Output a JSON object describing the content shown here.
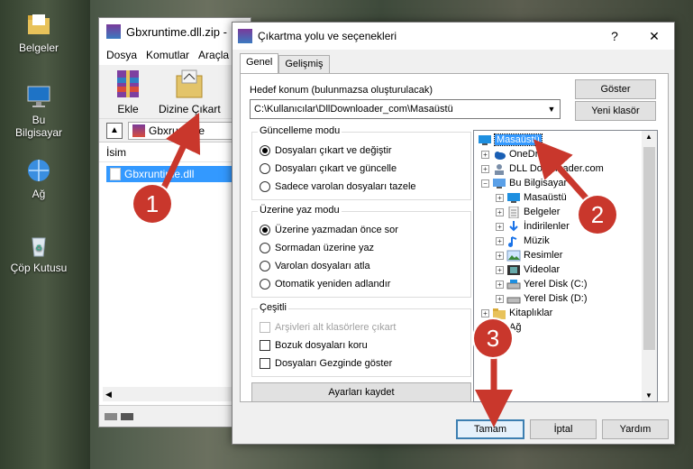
{
  "desktop": {
    "icons": [
      {
        "label": "Belgeler"
      },
      {
        "label": "Bu Bilgisayar"
      },
      {
        "label": "Ağ"
      },
      {
        "label": "Çöp Kutusu"
      }
    ]
  },
  "winrar": {
    "title": "Gbxruntime.dll.zip -",
    "menu": [
      "Dosya",
      "Komutlar",
      "Araçla"
    ],
    "toolbar": {
      "add": "Ekle",
      "extract_to": "Dizine Çıkart"
    },
    "address": "Gbxruntime",
    "column_name": "İsim",
    "file": "Gbxruntime.dll"
  },
  "dialog": {
    "title": "Çıkartma yolu ve seçenekleri",
    "help_button": "?",
    "close_button": "✕",
    "tabs": [
      "Genel",
      "Gelişmiş"
    ],
    "destination_label": "Hedef konum (bulunmazsa oluşturulacak)",
    "destination_value": "C:\\Kullanıcılar\\DllDownloader_com\\Masaüstü",
    "show_button": "Göster",
    "new_folder_button": "Yeni klasör",
    "update_mode": {
      "title": "Güncelleme modu",
      "options": [
        "Dosyaları çıkart ve değiştir",
        "Dosyaları çıkart ve güncelle",
        "Sadece varolan dosyaları tazele"
      ],
      "selected": 0
    },
    "overwrite_mode": {
      "title": "Üzerine yaz modu",
      "options": [
        "Üzerine yazmadan önce sor",
        "Sormadan üzerine yaz",
        "Varolan dosyaları atla",
        "Otomatik yeniden adlandır"
      ],
      "selected": 0
    },
    "misc": {
      "title": "Çeşitli",
      "options": [
        "Arşivleri alt klasörlere çıkart",
        "Bozuk dosyaları koru",
        "Dosyaları Gezginde göster"
      ]
    },
    "save_settings_button": "Ayarları kaydet",
    "tree": [
      {
        "label": "Masaüstü",
        "selected": true
      },
      {
        "label": "OneDrive"
      },
      {
        "label": "DLL Downloader.com"
      },
      {
        "label": "Bu Bilgisayar"
      },
      {
        "label": "Masaüstü"
      },
      {
        "label": "Belgeler"
      },
      {
        "label": "İndirilenler"
      },
      {
        "label": "Müzik"
      },
      {
        "label": "Resimler"
      },
      {
        "label": "Videolar"
      },
      {
        "label": "Yerel Disk (C:)"
      },
      {
        "label": "Yerel Disk (D:)"
      },
      {
        "label": "Kitaplıklar"
      },
      {
        "label": "Ağ"
      }
    ],
    "ok_button": "Tamam",
    "cancel_button": "İptal",
    "help_bottom_button": "Yardım"
  },
  "annotations": {
    "step1": "1",
    "step2": "2",
    "step3": "3",
    "color": "#c9372c"
  }
}
